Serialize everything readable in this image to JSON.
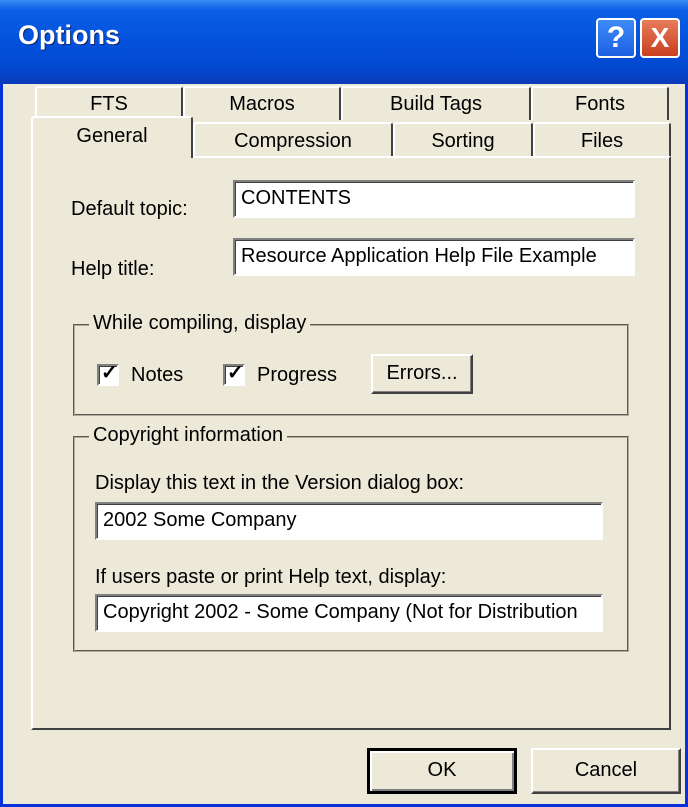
{
  "window": {
    "title": "Options",
    "help_glyph": "?",
    "close_glyph": "X"
  },
  "tabs": {
    "back_row": [
      "FTS",
      "Macros",
      "Build Tags",
      "Fonts"
    ],
    "front_row": [
      "General",
      "Compression",
      "Sorting",
      "Files"
    ],
    "selected": "General"
  },
  "general": {
    "default_topic_label": "Default topic:",
    "default_topic_value": "CONTENTS",
    "help_title_label": "Help title:",
    "help_title_value": "Resource Application Help File Example"
  },
  "compile_group": {
    "legend": "While compiling, display",
    "notes_label": "Notes",
    "notes_checked": true,
    "progress_label": "Progress",
    "progress_checked": true,
    "errors_button": "Errors..."
  },
  "copyright_group": {
    "legend": "Copyright information",
    "version_label": "Display this text in the Version dialog box:",
    "version_value": "2002 Some Company",
    "paste_label": "If users paste or print Help text, display:",
    "paste_value": "Copyright 2002 - Some Company (Not for Distribution"
  },
  "footer": {
    "ok": "OK",
    "cancel": "Cancel"
  },
  "icons": [
    "help-icon",
    "close-icon",
    "checkmark-icon"
  ],
  "colors": {
    "titlebar": "#0451dc",
    "face": "#ece9d8",
    "close": "#c8401f"
  }
}
